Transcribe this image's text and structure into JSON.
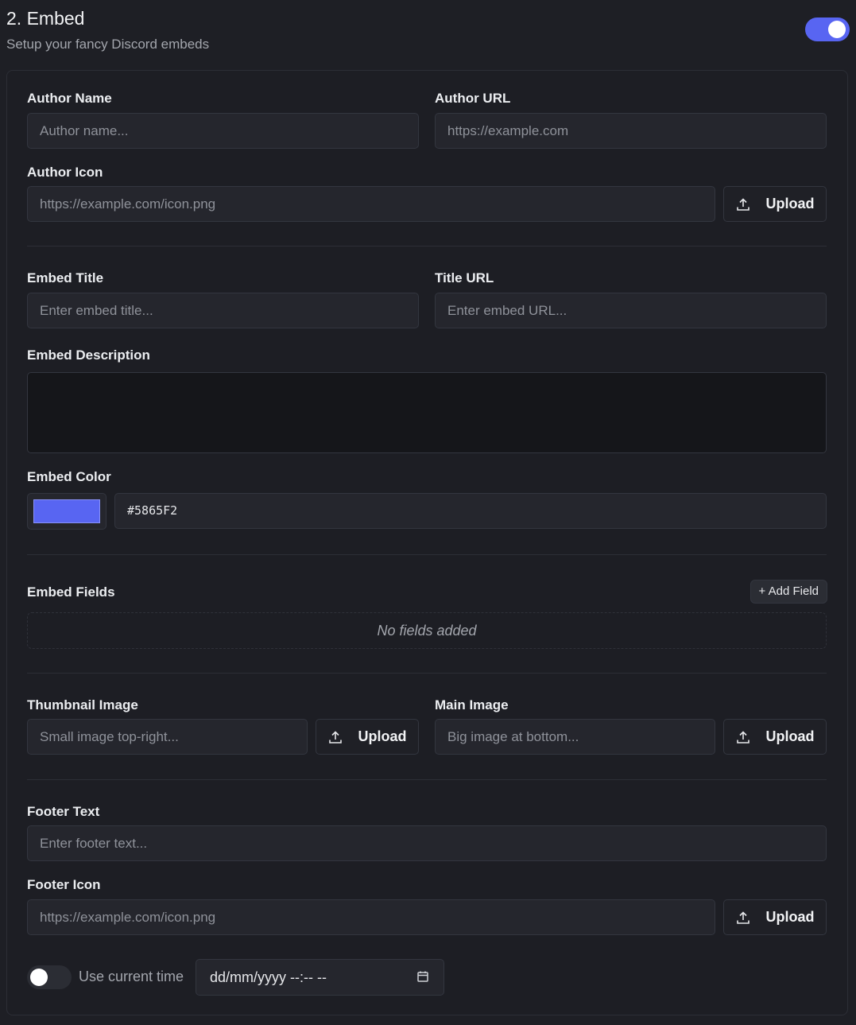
{
  "header": {
    "title": "2. Embed",
    "subtitle": "Setup your fancy Discord embeds",
    "enabled": true
  },
  "author": {
    "name_label": "Author Name",
    "name_placeholder": "Author name...",
    "url_label": "Author URL",
    "url_placeholder": "https://example.com",
    "icon_label": "Author Icon",
    "icon_placeholder": "https://example.com/icon.png",
    "upload_label": "Upload"
  },
  "body": {
    "title_label": "Embed Title",
    "title_placeholder": "Enter embed title...",
    "title_url_label": "Title URL",
    "title_url_placeholder": "Enter embed URL...",
    "description_label": "Embed Description",
    "color_label": "Embed Color",
    "color_value": "#5865F2"
  },
  "fields": {
    "label": "Embed Fields",
    "add_label": "+ Add Field",
    "empty_text": "No fields added"
  },
  "images": {
    "thumbnail_label": "Thumbnail Image",
    "thumbnail_placeholder": "Small image top-right...",
    "main_label": "Main Image",
    "main_placeholder": "Big image at bottom...",
    "upload_label": "Upload"
  },
  "footer": {
    "text_label": "Footer Text",
    "text_placeholder": "Enter footer text...",
    "icon_label": "Footer Icon",
    "icon_placeholder": "https://example.com/icon.png",
    "upload_label": "Upload",
    "use_current_time_label": "Use current time",
    "use_current_time": false,
    "datetime_placeholder": "dd/mm/yyyy --:-- --"
  },
  "colors": {
    "accent": "#5865F2",
    "background": "#1e1f25",
    "input_bg": "#25262d"
  }
}
